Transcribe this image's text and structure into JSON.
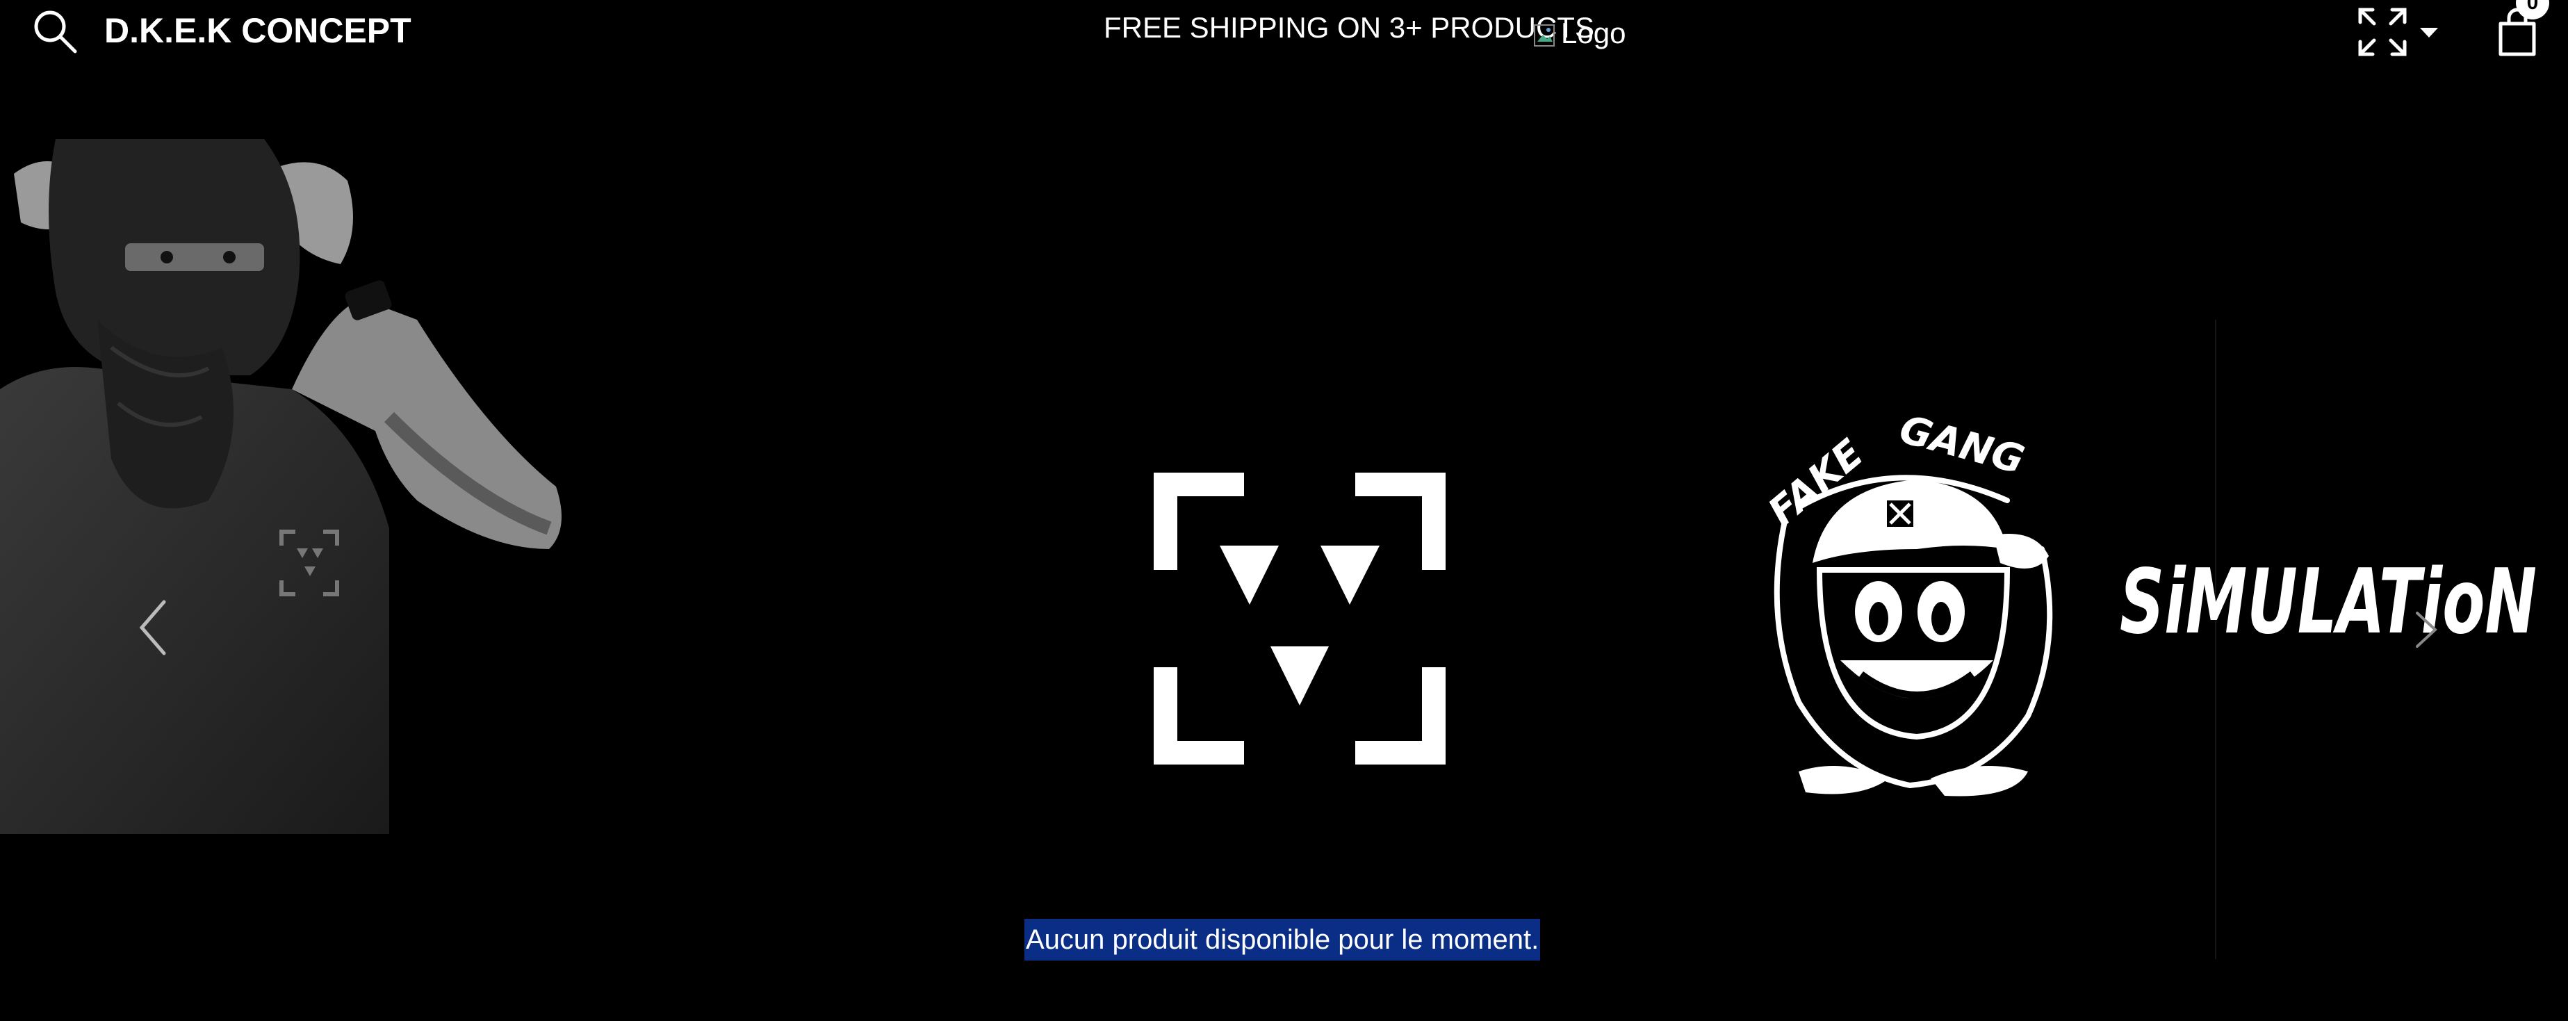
{
  "header": {
    "brand": "D.K.E.K CONCEPT",
    "announcement": "FREE SHIPPING ON 3+ PRODUCTS",
    "logo_alt": "Logo",
    "cart_count": "0"
  },
  "hero": {
    "slides": [
      {
        "name": "person-photo",
        "label": ""
      },
      {
        "name": "dkek-logo",
        "label": ""
      },
      {
        "name": "fake-gang-logo",
        "text": "FAKE GANG"
      },
      {
        "name": "simulation-logo",
        "text": "SiMULATioN"
      }
    ]
  },
  "products": {
    "empty_message": "Aucun produit disponible pour le moment."
  },
  "icons": [
    "search-icon",
    "expand-icon",
    "caret-down-icon",
    "cart-icon",
    "chevron-left-icon",
    "chevron-right-icon"
  ],
  "colors": {
    "background": "#000000",
    "text": "#ffffff",
    "selection": "#0a2d86"
  }
}
